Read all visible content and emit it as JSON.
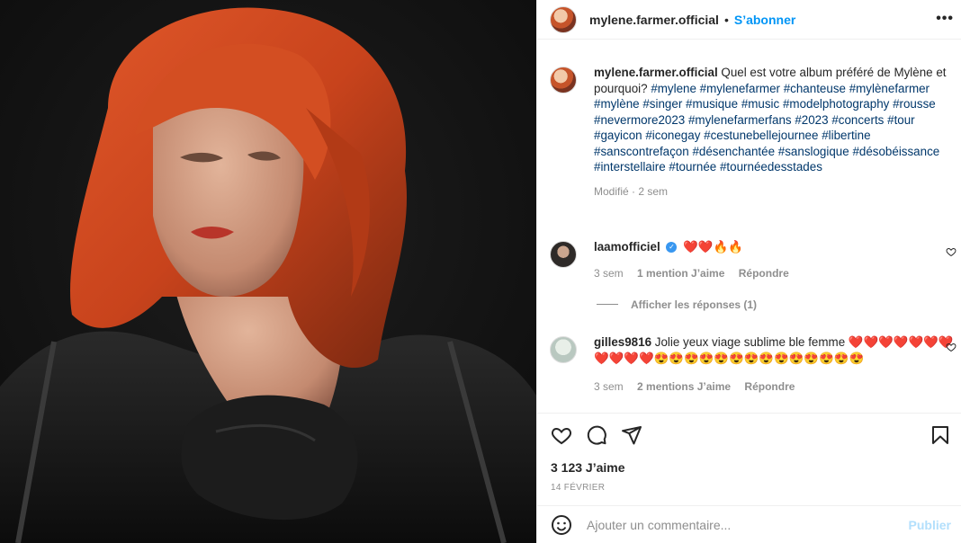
{
  "post": {
    "username": "mylene.farmer.official",
    "follow_label": "S’abonner",
    "header_dot": "•",
    "more_label": "•••",
    "caption_text": "Quel est votre album préféré de Mylène et pourquoi?",
    "hashtags": [
      "#mylene",
      "#mylenefarmer",
      "#chanteuse",
      "#mylènefarmer",
      "#mylène",
      "#singer",
      "#musique",
      "#music",
      "#modelphotography",
      "#rousse",
      "#nevermore2023",
      "#mylenefarmerfans",
      "#2023",
      "#concerts",
      "#tour",
      "#gayicon",
      "#iconegay",
      "#cestunebellejournee",
      "#libertine",
      "#sanscontrefaçon",
      "#désenchantée",
      "#sanslogique",
      "#désobéissance",
      "#interstellaire",
      "#tournée",
      "#tournéedesstades"
    ],
    "caption_meta": "Modifié · 2 sem",
    "likes": "3 123 J’aime",
    "date": "14 FÉVRIER",
    "add_comment_placeholder": "Ajouter un commentaire...",
    "publish_label": "Publier"
  },
  "comments": [
    {
      "username": "laamofficiel",
      "verified": true,
      "text": "❤️❤️🔥🔥",
      "time": "3 sem",
      "likes": "1 mention J’aime",
      "reply_label": "Répondre",
      "view_replies": "Afficher les réponses (1)"
    },
    {
      "username": "gilles9816",
      "verified": false,
      "text": "Jolie yeux viage sublime ble femme ❤️❤️❤️❤️❤️❤️❤️❤️❤️❤️❤️😍😍😍😍😍😍😍😍😍😍😍😍😍😍",
      "time": "3 sem",
      "likes": "2 mentions J’aime",
      "reply_label": "Répondre"
    }
  ],
  "icons": {
    "like": "heart-icon",
    "comment": "comment-icon",
    "share": "paper-plane-icon",
    "save": "bookmark-icon",
    "emoji": "emoji-icon",
    "more": "more-icon"
  },
  "colors": {
    "link_blue": "#0095f6",
    "hashtag": "#00376b",
    "meta_gray": "#8e8e8e",
    "verified": "#3897f0",
    "publish_disabled": "#b2dffc"
  }
}
